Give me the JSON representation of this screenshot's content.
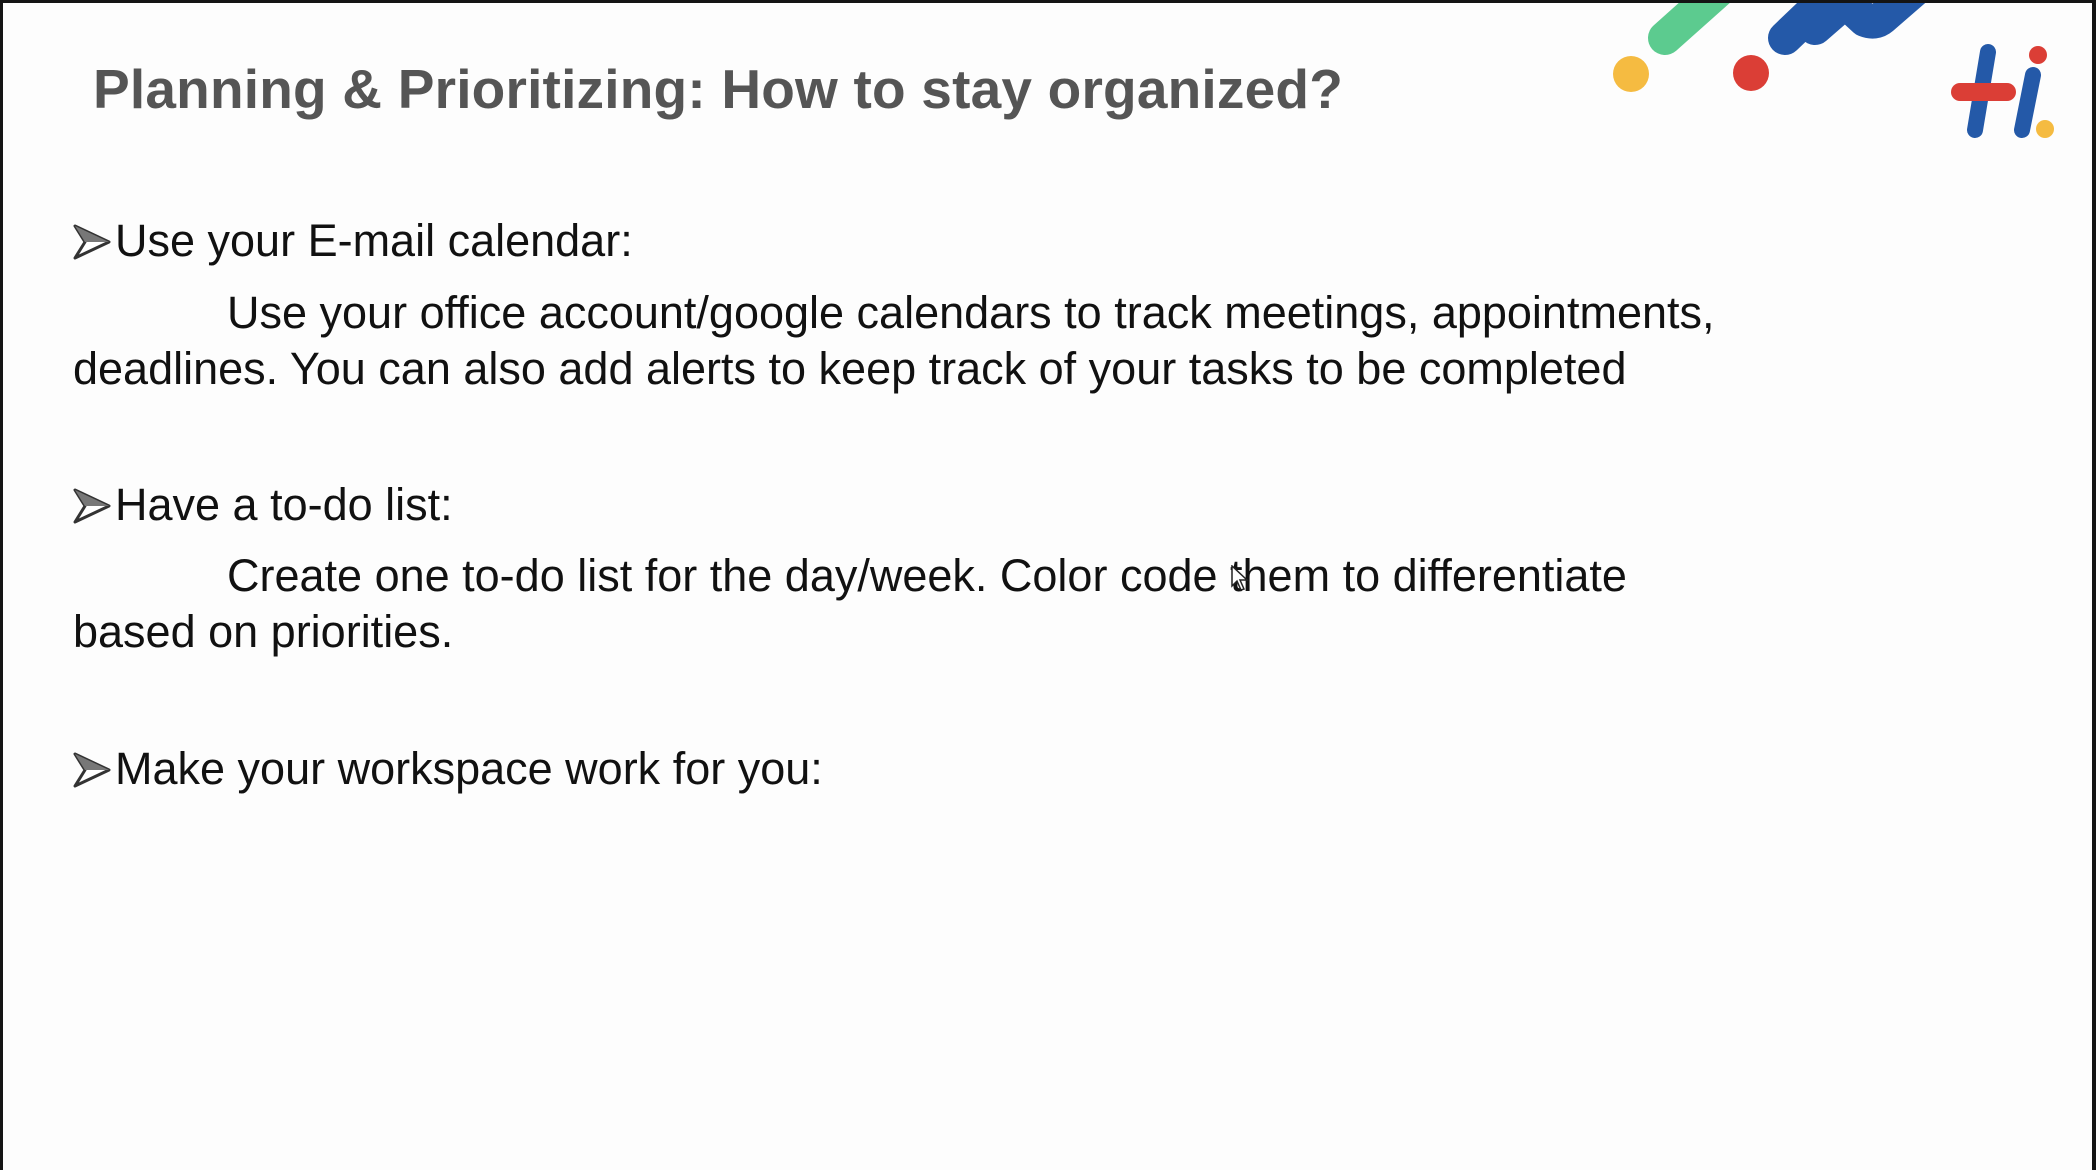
{
  "slide": {
    "title": "Planning & Prioritizing: How to stay organized?",
    "sections": [
      {
        "heading": "Use your E-mail calendar:",
        "body_lines": [
          "Use your  office account/google calendars to track meetings, appointments,",
          "deadlines. You can also add alerts to keep track of your tasks to be completed"
        ]
      },
      {
        "heading": "Have a to-do list:",
        "body_lines": [
          "Create one to-do list for the day/week. Color code them to differentiate",
          "based on priorities."
        ]
      },
      {
        "heading": "Make your workspace work for you:",
        "body_lines": []
      }
    ],
    "logo_text": "hi.",
    "colors": {
      "green": "#5ccb8f",
      "blue": "#2459a8",
      "red": "#db3e36",
      "yellow": "#f5bb41",
      "title": "#555555"
    }
  }
}
